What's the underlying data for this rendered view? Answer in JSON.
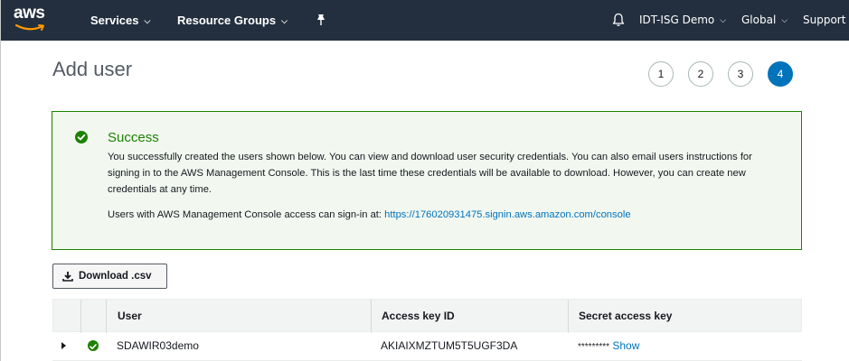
{
  "nav": {
    "logo": "aws",
    "services": "Services",
    "resource_groups": "Resource Groups",
    "account": "IDT-ISG Demo",
    "region": "Global",
    "support": "Support"
  },
  "page": {
    "title": "Add user",
    "steps": [
      "1",
      "2",
      "3",
      "4"
    ],
    "active_step": 4
  },
  "alert": {
    "title": "Success",
    "body": "You successfully created the users shown below. You can view and download user security credentials. You can also email users instructions for signing in to the AWS Management Console. This is the last time these credentials will be available to download. However, you can create new credentials at any time.",
    "signin_prefix": "Users with AWS Management Console access can sign-in at: ",
    "signin_url": "https://176020931475.signin.aws.amazon.com/console"
  },
  "download_button": "Download .csv",
  "table": {
    "headers": [
      "User",
      "Access key ID",
      "Secret access key"
    ],
    "rows": [
      {
        "user": "SDAWIR03demo",
        "access_key_id": "AKIAIXMZTUM5T5UGF3DA",
        "secret_masked": "*********",
        "secret_show": "Show"
      }
    ]
  },
  "colors": {
    "nav_bg": "#232f3e",
    "success": "#1d8102",
    "alert_bg": "#f2f8f0",
    "link": "#0073bb",
    "active_step": "#0073bb"
  }
}
